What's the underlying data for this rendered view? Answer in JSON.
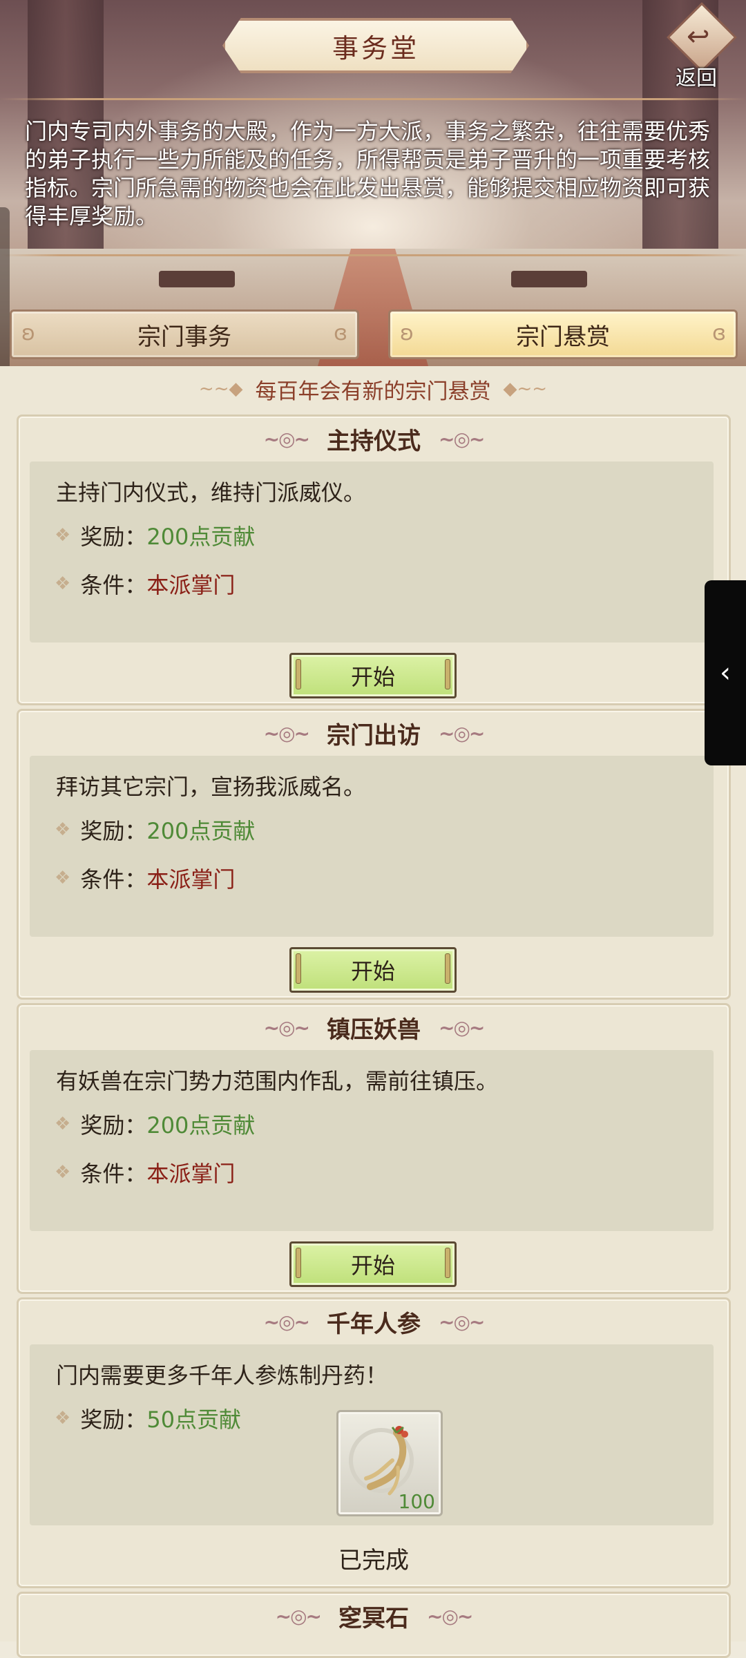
{
  "header": {
    "title": "事务堂",
    "back_label": "返回",
    "intro": "门内专司内外事务的大殿，作为一方大派，事务之繁杂，往往需要优秀的弟子执行一些力所能及的任务，所得帮贡是弟子晋升的一项重要考核指标。宗门所急需的物资也会在此发出悬赏，能够提交相应物资即可获得丰厚奖励。"
  },
  "tabs": [
    {
      "label": "宗门事务",
      "selected": false
    },
    {
      "label": "宗门悬赏",
      "selected": true
    }
  ],
  "notice": "每百年会有新的宗门悬赏",
  "labels": {
    "reward": "奖励：",
    "condition": "条件："
  },
  "cards": [
    {
      "title": "主持仪式",
      "desc": "主持门内仪式，维持门派威仪。",
      "reward": "200点贡献",
      "condition": "本派掌门",
      "button": "开始"
    },
    {
      "title": "宗门出访",
      "desc": "拜访其它宗门，宣扬我派威名。",
      "reward": "200点贡献",
      "condition": "本派掌门",
      "button": "开始"
    },
    {
      "title": "镇压妖兽",
      "desc": "有妖兽在宗门势力范围内作乱，需前往镇压。",
      "reward": "200点贡献",
      "condition": "本派掌门",
      "button": "开始"
    },
    {
      "title": "千年人参",
      "desc": "门内需要更多千年人参炼制丹药！",
      "reward": "50点贡献",
      "item_icon": "ginseng-icon",
      "item_count": "100",
      "status": "已完成"
    },
    {
      "title": "窆冥石"
    }
  ],
  "side_toggle_icon": "chevron-left-icon",
  "colors": {
    "reward": "#4f8a37",
    "condition": "#8a1f16",
    "start_button": "#c8e78a"
  }
}
